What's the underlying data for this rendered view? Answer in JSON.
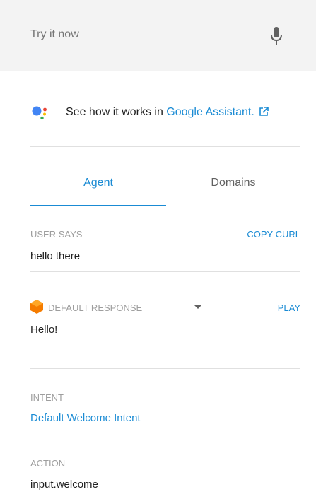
{
  "search": {
    "placeholder": "Try it now",
    "icon": "mic-icon"
  },
  "assistant": {
    "prefix": "See how it works in ",
    "link": "Google Assistant.",
    "logo_colors": [
      "#4285F4",
      "#EA4335",
      "#FBBC05",
      "#34A853"
    ]
  },
  "tabs": [
    {
      "label": "Agent",
      "active": true
    },
    {
      "label": "Domains",
      "active": false
    }
  ],
  "user_says": {
    "label": "USER SAYS",
    "action": "COPY CURL",
    "value": "hello there"
  },
  "response": {
    "label": "DEFAULT RESPONSE",
    "action": "PLAY",
    "value": "Hello!"
  },
  "intent": {
    "label": "INTENT",
    "value": "Default Welcome Intent"
  },
  "action": {
    "label": "ACTION",
    "value": "input.welcome"
  },
  "colors": {
    "accent": "#1a8bd4",
    "response_icon": "#f57c00",
    "label": "#9e9e9e"
  }
}
